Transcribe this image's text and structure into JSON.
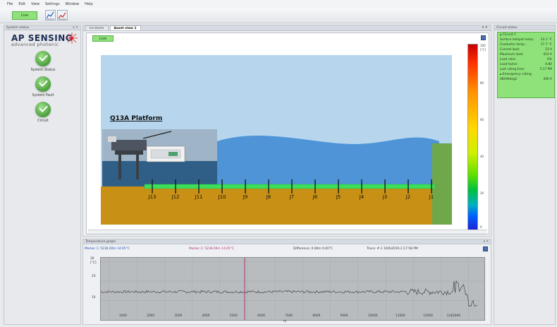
{
  "menubar": {
    "items": [
      "File",
      "Edit",
      "View",
      "Settings",
      "Window",
      "Help"
    ]
  },
  "toolbar": {
    "live_label": "Live"
  },
  "left_pane": {
    "title": "System status",
    "logo_top": "AP SENSING",
    "logo_bottom": "advanced photonic",
    "items": [
      {
        "label": "System Status"
      },
      {
        "label": "System Fault"
      },
      {
        "label": "Circuit"
      }
    ]
  },
  "asset_pane": {
    "tabs": [
      {
        "label": "Incidents"
      },
      {
        "label": "Asset view 1"
      }
    ],
    "live_label": "Live",
    "platform_label": "Q13A Platform",
    "joints": [
      "J13",
      "J12",
      "J11",
      "J10",
      "J9",
      "J8",
      "J7",
      "J6",
      "J5",
      "J4",
      "J3",
      "J2",
      "J1"
    ],
    "colorbar": {
      "unit": "[°C]",
      "ticks": [
        "100",
        "80",
        "60",
        "40",
        "20",
        "0"
      ]
    }
  },
  "circuit_pane": {
    "title": "Circuit status",
    "circuit_name": "Circuit 1",
    "rows": [
      {
        "label": "Surface hotspot temp.:",
        "value": "23.1 °C"
      },
      {
        "label": "Conductor temp.:",
        "value": "17.7 °C"
      },
      {
        "label": "Current load:",
        "value": "23 A"
      },
      {
        "label": "Maximum load:",
        "value": "410 A"
      },
      {
        "label": "Load ratio:",
        "value": "6%"
      },
      {
        "label": "Load factor:",
        "value": "0.80"
      },
      {
        "label": "Last rating time:",
        "value": "2:17 PM"
      }
    ],
    "emergency_label": "Emergency rating",
    "emergency_row": {
      "label": "48h90degC",
      "value": "490 A"
    }
  },
  "graph_pane": {
    "title": "Temperature graph",
    "marker1": "Marker 1: 5238.00m 14.65°C",
    "marker2": "Marker 2: 5238.00m 14.65°C",
    "difference": "Difference: 0.00m 0.00°C",
    "trace": "Trace: #-1 10/6/2016 2:17:58 PM",
    "y_unit": "[°C]",
    "y_ticks": [
      "30",
      "20",
      "10"
    ],
    "x_ticks": [
      "1000",
      "2000",
      "3000",
      "4000",
      "5000",
      "6000",
      "7000",
      "8000",
      "9000",
      "10000",
      "11000",
      "12000",
      "13000"
    ],
    "x_unit": "[m]",
    "x_label": "m"
  },
  "colors": {
    "live_green": "#8fe27a",
    "sky": "#b7d6ee",
    "sea": "#4f94d6",
    "seabed": "#c89116",
    "cable": "#3ce05a",
    "marker": "#b0307a"
  }
}
